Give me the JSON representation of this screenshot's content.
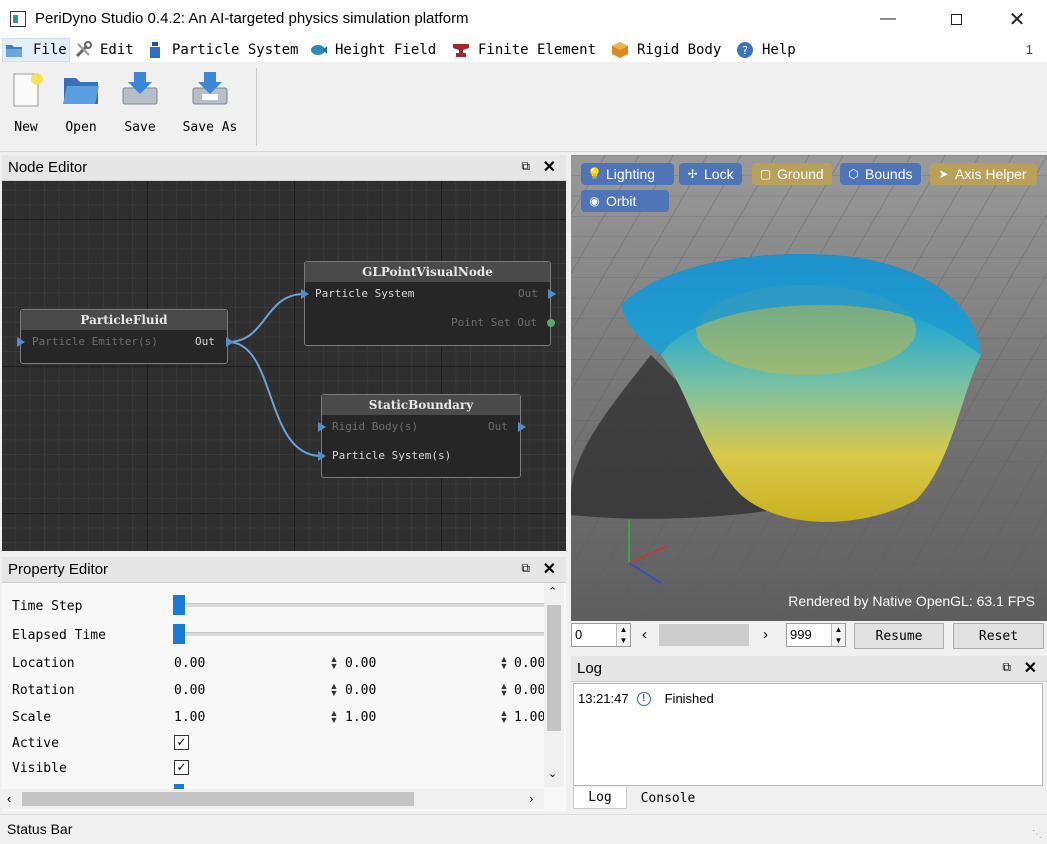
{
  "window": {
    "title": "PeriDyno Studio 0.4.2:  An AI-targeted physics simulation platform"
  },
  "menu": {
    "items": [
      {
        "label": "File",
        "icon": "folder-icon"
      },
      {
        "label": "Edit",
        "icon": "tools-icon"
      },
      {
        "label": "Particle System",
        "icon": "bottle-icon"
      },
      {
        "label": "Height Field",
        "icon": "fish-icon"
      },
      {
        "label": "Finite Element",
        "icon": "anvil-icon"
      },
      {
        "label": "Rigid Body",
        "icon": "cube-icon"
      },
      {
        "label": "Help",
        "icon": "question-icon"
      }
    ],
    "page_number": "1"
  },
  "toolbar": {
    "new": "New",
    "open": "Open",
    "save": "Save",
    "save_as": "Save As"
  },
  "node_editor": {
    "title": "Node Editor",
    "nodes": {
      "particle_fluid": {
        "title": "ParticleFluid",
        "in": "Particle Emitter(s)",
        "out": "Out"
      },
      "gl_point": {
        "title": "GLPointVisualNode",
        "in": "Particle System",
        "out": "Out",
        "out2": "Point Set Out"
      },
      "static_boundary": {
        "title": "StaticBoundary",
        "in1": "Rigid Body(s)",
        "in2": "Particle System(s)",
        "out": "Out"
      }
    }
  },
  "property_editor": {
    "title": "Property Editor",
    "rows": {
      "time_step": "Time Step",
      "elapsed_time": "Elapsed Time",
      "location": {
        "label": "Location",
        "values": [
          "0.00",
          "0.00",
          "0.00"
        ]
      },
      "rotation": {
        "label": "Rotation",
        "values": [
          "0.00",
          "0.00",
          "0.00"
        ]
      },
      "scale": {
        "label": "Scale",
        "values": [
          "1.00",
          "1.00",
          "1.00"
        ]
      },
      "active": {
        "label": "Active",
        "checked": true
      },
      "visible": {
        "label": "Visible",
        "checked": true
      }
    }
  },
  "viewport": {
    "buttons": {
      "lighting": "Lighting",
      "lock": "Lock",
      "ground": "Ground",
      "bounds": "Bounds",
      "axis_helper": "Axis Helper",
      "orbit": "Orbit"
    },
    "fps": "Rendered by Native OpenGL: 63.1 FPS"
  },
  "timeline": {
    "start": "0",
    "end": "999",
    "resume": "Resume",
    "reset": "Reset"
  },
  "log": {
    "title": "Log",
    "entries": [
      {
        "time": "13:21:47",
        "message": "Finished"
      }
    ],
    "tabs": [
      "Log",
      "Console"
    ]
  },
  "status_bar": "Status Bar",
  "colors": {
    "accent": "#1a7bd6",
    "port": "#4f8fc9",
    "wire": "#6aa3d6"
  }
}
